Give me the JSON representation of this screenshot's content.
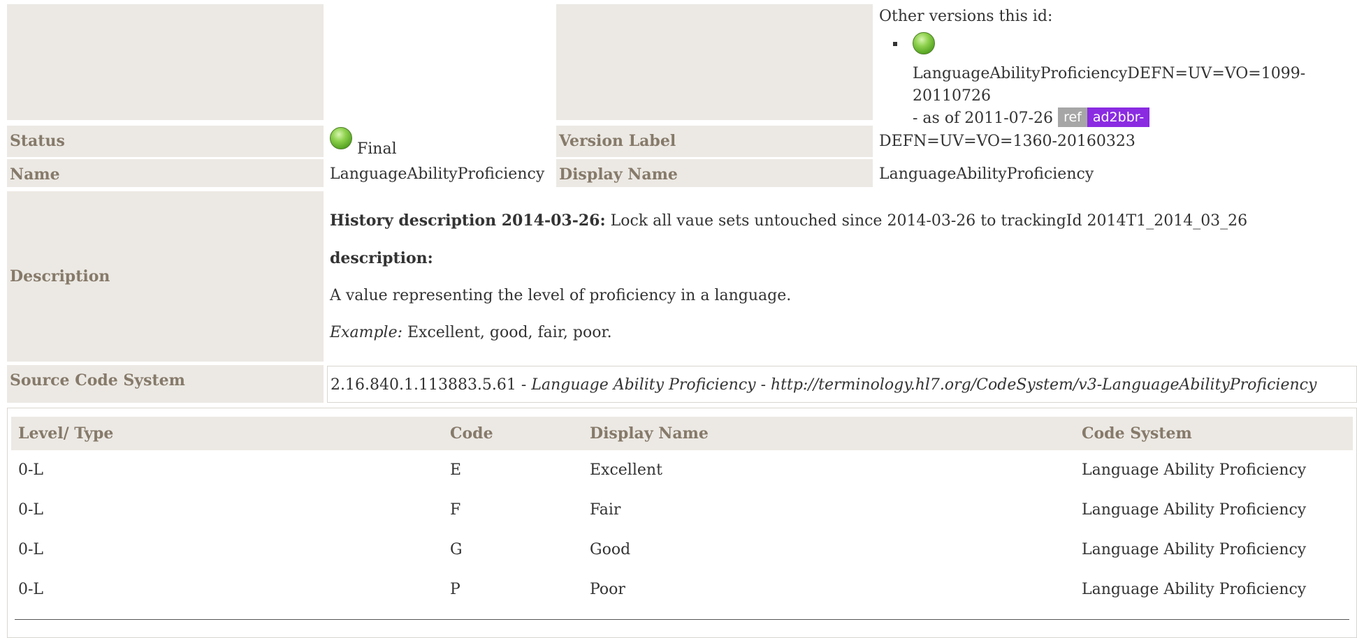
{
  "versions": {
    "heading": "Other versions this id:",
    "items": [
      {
        "name": "LanguageAbilityProficiencyDEFN=UV=VO=1099-20110726",
        "date_text": "- as of 2011-07-26",
        "badge_ref": "ref",
        "badge_id": "ad2bbr-"
      }
    ]
  },
  "fields": {
    "status_label": "Status",
    "status_value": "Final",
    "version_label": "Version Label",
    "version_value": "DEFN=UV=VO=1360-20160323",
    "name_label": "Name",
    "name_value": "LanguageAbilityProficiency",
    "display_name_label": "Display Name",
    "display_name_value": "LanguageAbilityProficiency",
    "description_label": "Description",
    "source_label": "Source Code System"
  },
  "description": {
    "history_label": "History description 2014-03-26:",
    "history_text": "Lock all vaue sets untouched since 2014-03-26 to trackingId 2014T1_2014_03_26",
    "desc_label": "description:",
    "desc_text": "A value representing the level of proficiency in a language.",
    "example_label": "Example:",
    "example_text": "Excellent, good, fair, poor."
  },
  "source": {
    "oid": "2.16.840.1.113883.5.61",
    "sep1": " - ",
    "name": "Language Ability Proficiency",
    "sep2": " - ",
    "url": "http://terminology.hl7.org/CodeSystem/v3-LanguageAbilityProficiency"
  },
  "codes_table": {
    "headers": [
      "Level/ Type",
      "Code",
      "Display Name",
      "Code System"
    ],
    "rows": [
      [
        "0-L",
        "E",
        "Excellent",
        "Language Ability Proficiency"
      ],
      [
        "0-L",
        "F",
        "Fair",
        "Language Ability Proficiency"
      ],
      [
        "0-L",
        "G",
        "Good",
        "Language Ability Proficiency"
      ],
      [
        "0-L",
        "P",
        "Poor",
        "Language Ability Proficiency"
      ]
    ]
  },
  "colors": {
    "label_bg": "#ece9e4",
    "label_text": "#867a6a",
    "badge_ref": "#a6a6a6",
    "badge_id": "#8a2be2",
    "status_final": "#6cbf2c"
  }
}
